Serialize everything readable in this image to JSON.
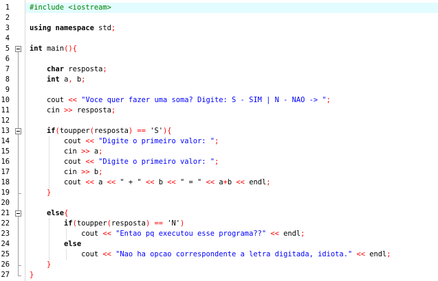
{
  "editor": {
    "highlighted_line": 1,
    "lines": [
      {
        "n": "1",
        "tokens": [
          {
            "t": "#include <iostream>",
            "c": "pre"
          }
        ]
      },
      {
        "n": "2",
        "tokens": []
      },
      {
        "n": "3",
        "tokens": [
          {
            "t": "using namespace ",
            "c": "kw"
          },
          {
            "t": "std",
            "c": "id"
          },
          {
            "t": ";",
            "c": "op"
          }
        ]
      },
      {
        "n": "4",
        "tokens": []
      },
      {
        "n": "5",
        "tokens": [
          {
            "t": "int ",
            "c": "kw"
          },
          {
            "t": "main",
            "c": "id"
          },
          {
            "t": "(){",
            "c": "op"
          }
        ]
      },
      {
        "n": "6",
        "tokens": []
      },
      {
        "n": "7",
        "tokens": [
          {
            "t": "    "
          },
          {
            "t": "char ",
            "c": "kw"
          },
          {
            "t": "resposta",
            "c": "id"
          },
          {
            "t": ";",
            "c": "op"
          }
        ]
      },
      {
        "n": "8",
        "tokens": [
          {
            "t": "    "
          },
          {
            "t": "int ",
            "c": "kw"
          },
          {
            "t": "a",
            "c": "id"
          },
          {
            "t": ", ",
            "c": "op"
          },
          {
            "t": "b",
            "c": "id"
          },
          {
            "t": ";",
            "c": "op"
          }
        ]
      },
      {
        "n": "9",
        "tokens": []
      },
      {
        "n": "10",
        "tokens": [
          {
            "t": "    cout ",
            "c": "id"
          },
          {
            "t": "<< ",
            "c": "op"
          },
          {
            "t": "\"Voce quer fazer uma soma? Digite: S - SIM | N - NAO -> \"",
            "c": "str"
          },
          {
            "t": ";",
            "c": "op"
          }
        ]
      },
      {
        "n": "11",
        "tokens": [
          {
            "t": "    cin ",
            "c": "id"
          },
          {
            "t": ">> ",
            "c": "op"
          },
          {
            "t": "resposta",
            "c": "id"
          },
          {
            "t": ";",
            "c": "op"
          }
        ]
      },
      {
        "n": "12",
        "tokens": []
      },
      {
        "n": "13",
        "tokens": [
          {
            "t": "    "
          },
          {
            "t": "if",
            "c": "kw"
          },
          {
            "t": "(",
            "c": "op"
          },
          {
            "t": "toupper",
            "c": "id"
          },
          {
            "t": "(",
            "c": "op"
          },
          {
            "t": "resposta",
            "c": "id"
          },
          {
            "t": ") == ",
            "c": "op"
          },
          {
            "t": "'S'",
            "c": "id"
          },
          {
            "t": "){",
            "c": "op"
          }
        ]
      },
      {
        "n": "14",
        "tokens": [
          {
            "t": "        cout ",
            "c": "id"
          },
          {
            "t": "<< ",
            "c": "op"
          },
          {
            "t": "\"Digite o primeiro valor: \"",
            "c": "str"
          },
          {
            "t": ";",
            "c": "op"
          }
        ]
      },
      {
        "n": "15",
        "tokens": [
          {
            "t": "        cin ",
            "c": "id"
          },
          {
            "t": ">> ",
            "c": "op"
          },
          {
            "t": "a",
            "c": "id"
          },
          {
            "t": ";",
            "c": "op"
          }
        ]
      },
      {
        "n": "16",
        "tokens": [
          {
            "t": "        cout ",
            "c": "id"
          },
          {
            "t": "<< ",
            "c": "op"
          },
          {
            "t": "\"Digite o primeiro valor: \"",
            "c": "str"
          },
          {
            "t": ";",
            "c": "op"
          }
        ]
      },
      {
        "n": "17",
        "tokens": [
          {
            "t": "        cin ",
            "c": "id"
          },
          {
            "t": ">> ",
            "c": "op"
          },
          {
            "t": "b",
            "c": "id"
          },
          {
            "t": ";",
            "c": "op"
          }
        ]
      },
      {
        "n": "18",
        "tokens": [
          {
            "t": "        cout ",
            "c": "id"
          },
          {
            "t": "<< ",
            "c": "op"
          },
          {
            "t": "a ",
            "c": "id"
          },
          {
            "t": "<< ",
            "c": "op"
          },
          {
            "t": "\" + \" ",
            "c": "id"
          },
          {
            "t": "<< ",
            "c": "op"
          },
          {
            "t": "b ",
            "c": "id"
          },
          {
            "t": "<< ",
            "c": "op"
          },
          {
            "t": "\" = \" ",
            "c": "id"
          },
          {
            "t": "<< ",
            "c": "op"
          },
          {
            "t": "a",
            "c": "id"
          },
          {
            "t": "+",
            "c": "op"
          },
          {
            "t": "b ",
            "c": "id"
          },
          {
            "t": "<< ",
            "c": "op"
          },
          {
            "t": "endl",
            "c": "id"
          },
          {
            "t": ";",
            "c": "op"
          }
        ]
      },
      {
        "n": "19",
        "tokens": [
          {
            "t": "    "
          },
          {
            "t": "}",
            "c": "op"
          }
        ]
      },
      {
        "n": "20",
        "tokens": []
      },
      {
        "n": "21",
        "tokens": [
          {
            "t": "    "
          },
          {
            "t": "else",
            "c": "kw"
          },
          {
            "t": "{",
            "c": "op"
          }
        ]
      },
      {
        "n": "22",
        "tokens": [
          {
            "t": "        "
          },
          {
            "t": "if",
            "c": "kw"
          },
          {
            "t": "(",
            "c": "op"
          },
          {
            "t": "toupper",
            "c": "id"
          },
          {
            "t": "(",
            "c": "op"
          },
          {
            "t": "resposta",
            "c": "id"
          },
          {
            "t": ") == ",
            "c": "op"
          },
          {
            "t": "'N'",
            "c": "id"
          },
          {
            "t": ")",
            "c": "op"
          }
        ]
      },
      {
        "n": "23",
        "tokens": [
          {
            "t": "            cout ",
            "c": "id"
          },
          {
            "t": "<< ",
            "c": "op"
          },
          {
            "t": "\"Entao pq executou esse programa??\" ",
            "c": "str"
          },
          {
            "t": "<< ",
            "c": "op"
          },
          {
            "t": "endl",
            "c": "id"
          },
          {
            "t": ";",
            "c": "op"
          }
        ]
      },
      {
        "n": "24",
        "tokens": [
          {
            "t": "        "
          },
          {
            "t": "else",
            "c": "kw"
          }
        ]
      },
      {
        "n": "25",
        "tokens": [
          {
            "t": "            cout ",
            "c": "id"
          },
          {
            "t": "<< ",
            "c": "op"
          },
          {
            "t": "\"Nao ha opcao correspondente a letra digitada, idiota.\" ",
            "c": "str"
          },
          {
            "t": "<< ",
            "c": "op"
          },
          {
            "t": "endl",
            "c": "id"
          },
          {
            "t": ";",
            "c": "op"
          }
        ]
      },
      {
        "n": "26",
        "tokens": [
          {
            "t": "    "
          },
          {
            "t": "}",
            "c": "op"
          }
        ]
      },
      {
        "n": "27",
        "tokens": [
          {
            "t": "}",
            "c": "op"
          }
        ]
      }
    ],
    "fold_blocks": [
      {
        "start": 5,
        "end": 27
      },
      {
        "start": 13,
        "end": 19
      },
      {
        "start": 21,
        "end": 26
      }
    ],
    "colors": {
      "preprocessor": "#008000",
      "keyword": "#000000",
      "string": "#0000ff",
      "operator": "#ff0000",
      "current_line_bg": "#e3fcff"
    }
  }
}
